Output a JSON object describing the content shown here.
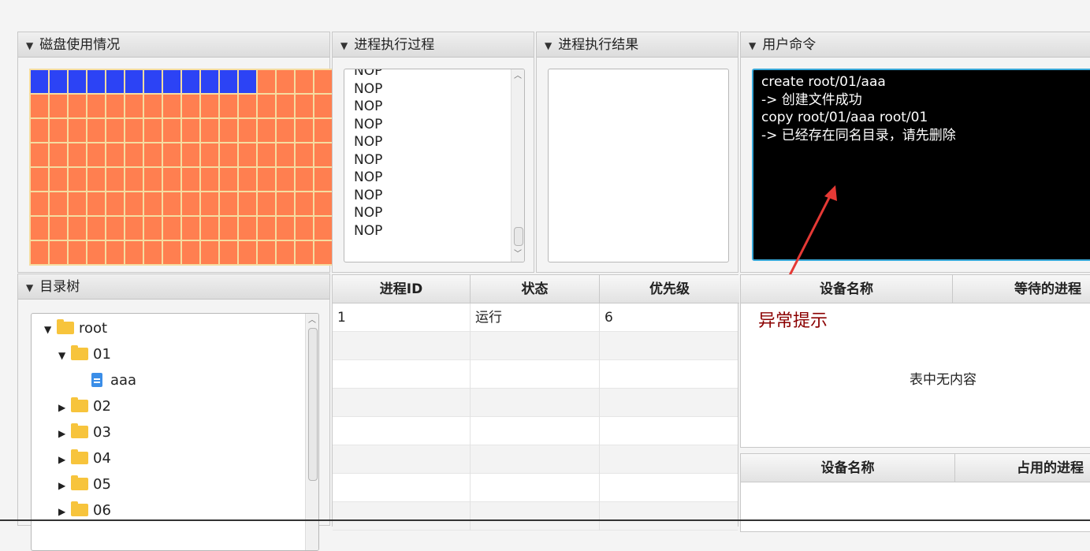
{
  "panels": {
    "disk": {
      "title": "磁盘使用情况"
    },
    "process": {
      "title": "进程执行过程"
    },
    "result": {
      "title": "进程执行结果"
    },
    "command": {
      "title": "用户命令"
    },
    "tree": {
      "title": "目录树"
    }
  },
  "disk": {
    "columns": 16,
    "rows": 8,
    "used_blocks": 12,
    "used_color": "#2c43f5",
    "free_color": "#ff7f50",
    "grid_line_color": "#f5dca0"
  },
  "process_log": [
    "NOP",
    "NOP",
    "NOP",
    "NOP",
    "NOP",
    "NOP",
    "NOP",
    "NOP",
    "NOP",
    "NOP"
  ],
  "console": {
    "lines": [
      "create root/01/aaa",
      "-> 创建文件成功",
      "copy root/01/aaa root/01",
      "-> 已经存在同名目录，请先删除"
    ],
    "annotation_color": "#e53935"
  },
  "tree": {
    "root_label": "root",
    "folder_01": "01",
    "file_aaa": "aaa",
    "folders": [
      "02",
      "03",
      "04",
      "05",
      "06"
    ]
  },
  "process_table": {
    "headers": [
      "进程ID",
      "状态",
      "优先级"
    ],
    "rows": [
      [
        "1",
        "运行",
        "6"
      ]
    ]
  },
  "device_wait_table": {
    "headers": [
      "设备名称",
      "等待的进程"
    ],
    "exception_label": "异常提示",
    "exception_color": "#8b0000",
    "empty_text": "表中无内容"
  },
  "device_occupy_table": {
    "headers": [
      "设备名称",
      "占用的进程"
    ]
  }
}
